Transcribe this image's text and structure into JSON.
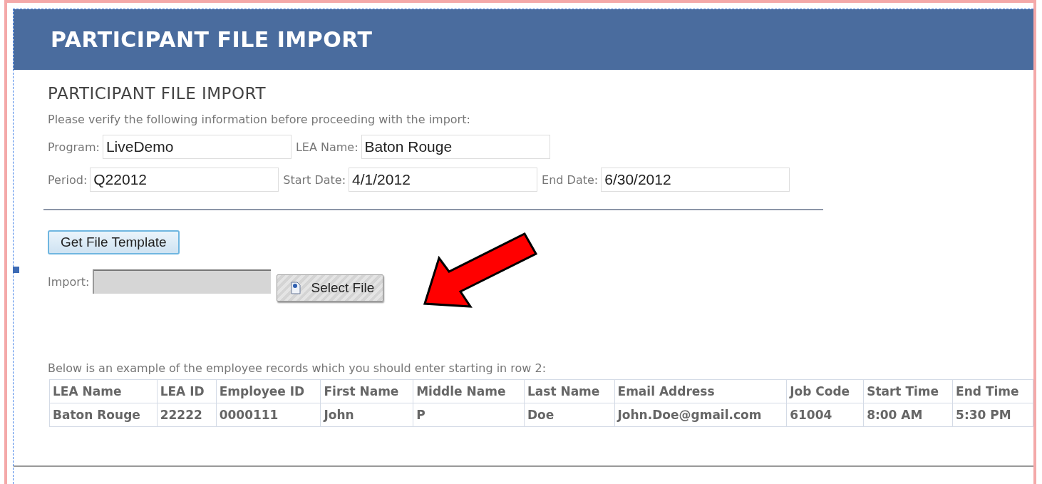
{
  "header": {
    "title": "PARTICIPANT FILE IMPORT"
  },
  "section_title": "PARTICIPANT FILE IMPORT",
  "instructions": "Please verify the following information before proceeding with the import:",
  "field_rows": [
    [
      {
        "label": "Program:",
        "value": "LiveDemo"
      },
      {
        "label": "LEA Name:",
        "value": "Baton Rouge"
      }
    ],
    [
      {
        "label": "Period:",
        "value": "Q22012"
      },
      {
        "label": "Start Date:",
        "value": "4/1/2012"
      },
      {
        "label": "End Date:",
        "value": "6/30/2012"
      }
    ]
  ],
  "template_button": "Get File Template",
  "import": {
    "label": "Import:",
    "button": "Select File"
  },
  "example_caption": "Below is an example of the employee records which you should enter starting in row 2:",
  "table": {
    "columns": [
      "LEA Name",
      "LEA ID",
      "Employee ID",
      "First Name",
      "Middle Name",
      "Last Name",
      "Email Address",
      "Job Code",
      "Start Time",
      "End Time"
    ],
    "rows": [
      [
        "Baton Rouge",
        "22222",
        "0000111",
        "John",
        "P",
        "Doe",
        "John.Doe@gmail.com",
        "61004",
        "8:00 AM",
        "5:30 PM"
      ]
    ]
  }
}
